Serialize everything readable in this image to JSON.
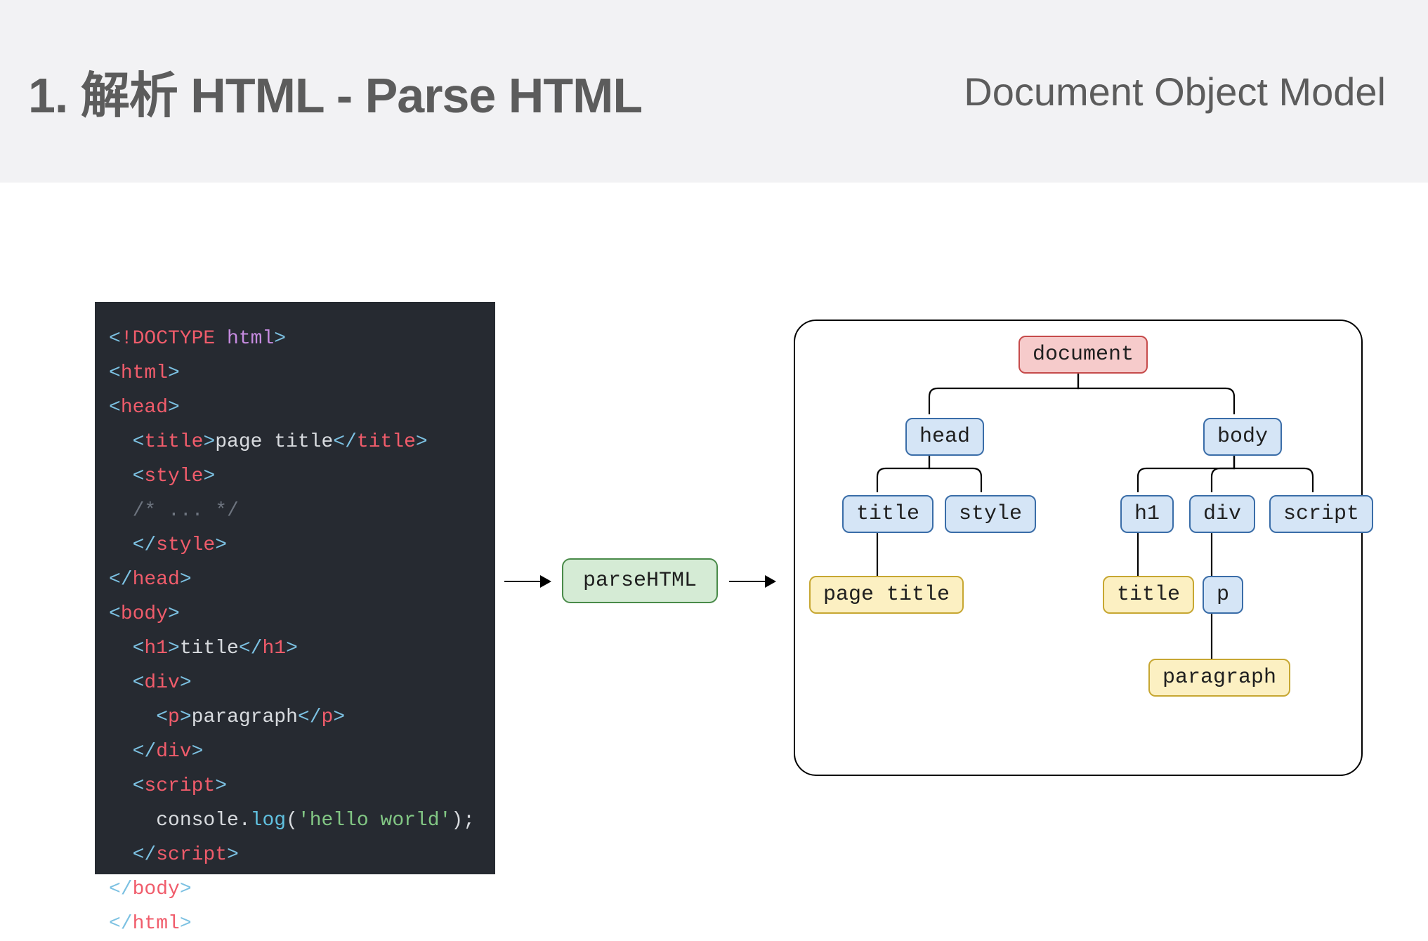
{
  "header": {
    "left_title": "1. 解析 HTML - Parse HTML",
    "right_title": "Document Object Model"
  },
  "parse_label": "parseHTML",
  "code": {
    "doctype_bang": "!DOCTYPE",
    "doctype_html": "html",
    "tag_html": "html",
    "tag_head": "head",
    "tag_title": "title",
    "txt_page_title": "page title",
    "tag_style": "style",
    "comment": "/* ... */",
    "tag_body": "body",
    "tag_h1": "h1",
    "txt_title": "title",
    "tag_div": "div",
    "tag_p": "p",
    "txt_para": "paragraph",
    "tag_script": "script",
    "console_obj": "console",
    "console_fun": "log",
    "console_str": "'hello world'"
  },
  "tree": {
    "document": "document",
    "head": "head",
    "body": "body",
    "title": "title",
    "style": "style",
    "h1": "h1",
    "div": "div",
    "script": "script",
    "page_title": "page title",
    "title_text": "title",
    "p": "p",
    "paragraph": "paragraph"
  }
}
